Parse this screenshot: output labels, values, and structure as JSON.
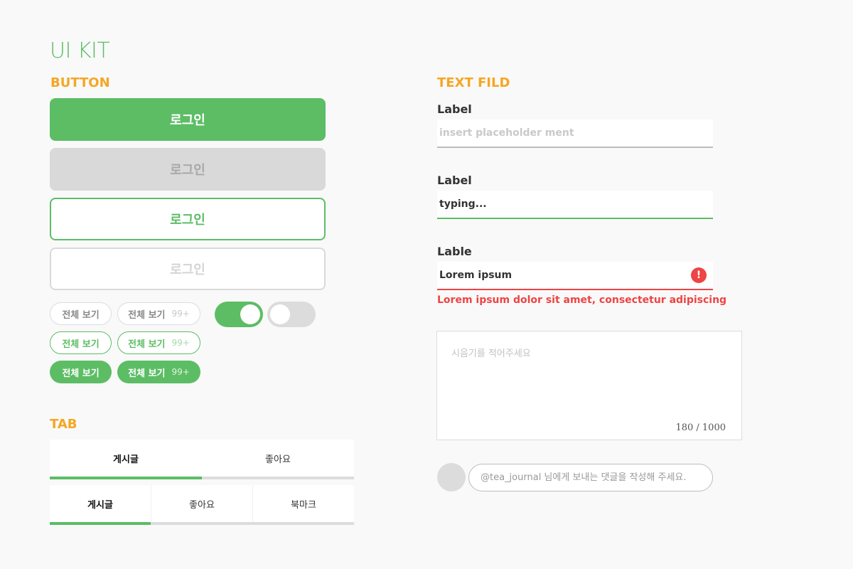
{
  "page_title": "UI KIT",
  "sections": {
    "button": "BUTTON",
    "tab": "TAB",
    "text_field": "TEXT FILD"
  },
  "buttons": {
    "primary": "로그인",
    "disabled": "로그인",
    "outline": "로그인",
    "outline_disabled": "로그인"
  },
  "chips": {
    "grey": {
      "label": "전체 보기",
      "count_label": "전체 보기",
      "count": "99+"
    },
    "outline": {
      "label": "전체 보기",
      "count_label": "전체 보기",
      "count": "99+"
    },
    "filled": {
      "label": "전체 보기",
      "count_label": "전체 보기",
      "count": "99+"
    }
  },
  "toggles": {
    "first": {
      "state": "on"
    },
    "second": {
      "state": "off"
    }
  },
  "tabs": {
    "two": {
      "items": [
        "게시글",
        "좋아요"
      ],
      "active_index": 0
    },
    "three": {
      "items": [
        "게시글",
        "좋아요",
        "북마크"
      ],
      "active_index": 0
    }
  },
  "text_fields": {
    "default": {
      "label": "Label",
      "value": "",
      "placeholder": "insert placeholder ment"
    },
    "focused": {
      "label": "Label",
      "value": "typing..."
    },
    "error": {
      "label": "Lable",
      "value": "Lorem ipsum",
      "error_icon": "!",
      "error_message": "Lorem ipsum dolor sit amet, consectetur adipiscing"
    }
  },
  "textarea": {
    "placeholder": "시음기를 적어주세요",
    "counter": "180 / 1000"
  },
  "comment": {
    "placeholder": "@tea_journal 님에게 보내는 댓글을 작성해 주세요."
  },
  "colors": {
    "green": "#5cbd65",
    "orange": "#f5a623",
    "error_red": "#ee4444",
    "grey": "#dcdcdc",
    "background": "#f9f9f9"
  }
}
